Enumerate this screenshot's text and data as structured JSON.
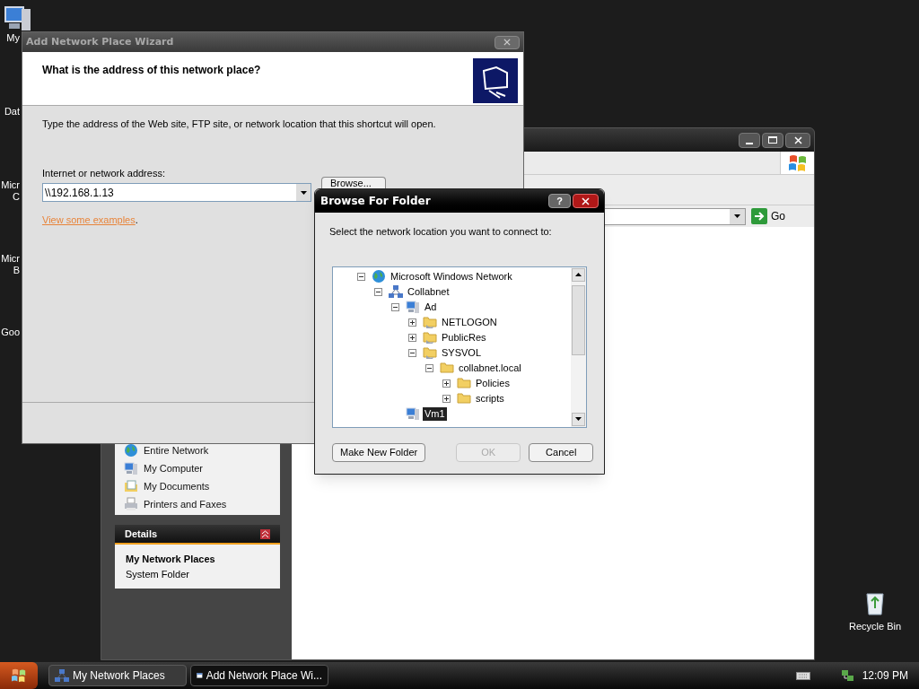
{
  "desktop": {
    "icons": [
      {
        "kind": "computer",
        "label_lines": [
          "My"
        ]
      },
      {
        "label_lines": [
          "Dat"
        ]
      },
      {
        "label_lines": [
          "Micr",
          "C"
        ]
      },
      {
        "label_lines": [
          "Micr",
          "B"
        ]
      },
      {
        "label_lines": [
          "Goo"
        ]
      }
    ],
    "recycle_bin": {
      "label": "Recycle Bin"
    }
  },
  "explorer_window": {
    "address": {
      "go_label": "Go"
    },
    "other_places": [
      {
        "kind": "globe",
        "label": "Entire Network"
      },
      {
        "kind": "computer",
        "label": "My Computer"
      },
      {
        "kind": "documents",
        "label": "My Documents"
      },
      {
        "kind": "printer",
        "label": "Printers and Faxes"
      }
    ],
    "details": {
      "title": "Details",
      "name": "My Network Places",
      "type": "System Folder"
    }
  },
  "wizard": {
    "title": "Add Network Place Wizard",
    "active": false,
    "heading": "What is the address of this network place?",
    "description": "Type the address of the Web site, FTP site, or network location that this shortcut will open.",
    "address_label": "Internet or network address:",
    "address_value": "\\\\192.168.1.13",
    "browse_button": "Browse...",
    "examples_link": "View some examples",
    "examples_after": "."
  },
  "browse_dialog": {
    "title": "Browse For Folder",
    "active": true,
    "help_button": "?",
    "prompt": "Select the network location you want to connect to:",
    "tree": [
      {
        "label": "Microsoft Windows Network",
        "kind": "globe",
        "expanded": true,
        "selected": false,
        "children": [
          {
            "label": "Collabnet",
            "kind": "workgroup",
            "expanded": true,
            "selected": false,
            "children": [
              {
                "label": "Ad",
                "kind": "computer",
                "expanded": true,
                "selected": false,
                "children": [
                  {
                    "label": "NETLOGON",
                    "kind": "share",
                    "expanded": false,
                    "selected": false
                  },
                  {
                    "label": "PublicRes",
                    "kind": "share",
                    "expanded": false,
                    "selected": false
                  },
                  {
                    "label": "SYSVOL",
                    "kind": "share",
                    "expanded": true,
                    "selected": false,
                    "children": [
                      {
                        "label": "collabnet.local",
                        "kind": "folder",
                        "expanded": true,
                        "selected": false,
                        "children": [
                          {
                            "label": "Policies",
                            "kind": "folder",
                            "expanded": false,
                            "selected": false
                          },
                          {
                            "label": "scripts",
                            "kind": "folder",
                            "expanded": false,
                            "selected": false
                          }
                        ]
                      }
                    ]
                  }
                ]
              },
              {
                "label": "Vm1",
                "kind": "computer",
                "selected": true
              }
            ]
          }
        ]
      }
    ],
    "buttons": [
      {
        "label": "Make New Folder",
        "disabled": false
      },
      {
        "label": "OK",
        "disabled": true
      },
      {
        "label": "Cancel",
        "disabled": false
      }
    ]
  },
  "taskbar": {
    "buttons": [
      {
        "kind": "network",
        "label": "My Network Places",
        "selected": false
      },
      {
        "kind": "window",
        "label": "Add Network Place Wi...",
        "selected": true
      }
    ],
    "clock": "12:09 PM"
  }
}
